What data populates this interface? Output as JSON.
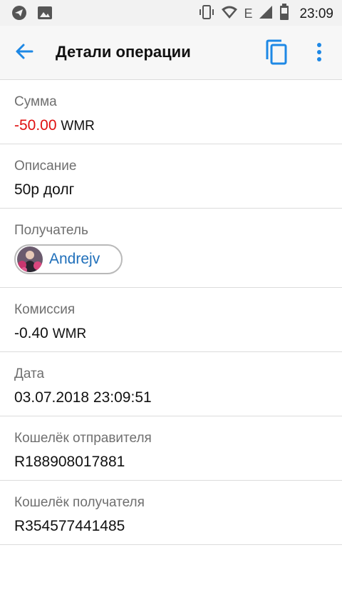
{
  "status": {
    "time": "23:09",
    "network_label": "E",
    "icons": [
      "telegram-icon",
      "image-icon",
      "vibrate-icon",
      "wifi-icon",
      "signal-icon",
      "battery-icon"
    ]
  },
  "appbar": {
    "title": "Детали операции",
    "icons": [
      "back-arrow-icon",
      "copy-icon",
      "more-vert-icon"
    ],
    "accent": "#1E88E5"
  },
  "details": {
    "amount": {
      "label": "Сумма",
      "value": "-50.00",
      "currency": "WMR",
      "color": "#E01010"
    },
    "description": {
      "label": "Описание",
      "value": "50р долг"
    },
    "recipient": {
      "label": "Получатель",
      "name": "Andrejv"
    },
    "fee": {
      "label": "Комиссия",
      "value": "-0.40",
      "currency": "WMR"
    },
    "date": {
      "label": "Дата",
      "value": "03.07.2018 23:09:51"
    },
    "sender_wallet": {
      "label": "Кошелёк отправителя",
      "value": "R188908017881"
    },
    "recipient_wallet": {
      "label": "Кошелёк получателя",
      "value": "R354577441485"
    }
  }
}
